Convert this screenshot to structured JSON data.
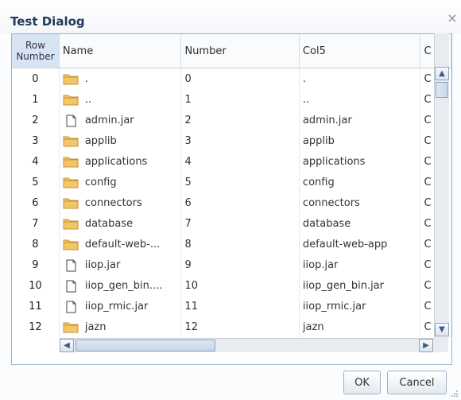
{
  "dialog": {
    "title": "Test Dialog",
    "close_glyph": "×"
  },
  "table": {
    "headers": {
      "row_number_line1": "Row",
      "row_number_line2": "Number",
      "name": "Name",
      "number": "Number",
      "col5": "Col5",
      "col6": "C"
    },
    "rows": [
      {
        "row": "0",
        "icon": "folder-icon",
        "name": ".",
        "number": "0",
        "col5": ".",
        "col6": "C"
      },
      {
        "row": "1",
        "icon": "folder-icon",
        "name": "..",
        "number": "1",
        "col5": "..",
        "col6": "C"
      },
      {
        "row": "2",
        "icon": "file-icon",
        "name": "admin.jar",
        "number": "2",
        "col5": "admin.jar",
        "col6": "C"
      },
      {
        "row": "3",
        "icon": "folder-icon",
        "name": "applib",
        "number": "3",
        "col5": "applib",
        "col6": "C"
      },
      {
        "row": "4",
        "icon": "folder-icon",
        "name": "applications",
        "number": "4",
        "col5": "applications",
        "col6": "C"
      },
      {
        "row": "5",
        "icon": "folder-icon",
        "name": "config",
        "number": "5",
        "col5": "config",
        "col6": "C"
      },
      {
        "row": "6",
        "icon": "folder-icon",
        "name": "connectors",
        "number": "6",
        "col5": "connectors",
        "col6": "C"
      },
      {
        "row": "7",
        "icon": "folder-icon",
        "name": "database",
        "number": "7",
        "col5": "database",
        "col6": "C"
      },
      {
        "row": "8",
        "icon": "folder-icon",
        "name": "default-web-...",
        "number": "8",
        "col5": "default-web-app",
        "col6": "C"
      },
      {
        "row": "9",
        "icon": "file-icon",
        "name": "iiop.jar",
        "number": "9",
        "col5": "iiop.jar",
        "col6": "C"
      },
      {
        "row": "10",
        "icon": "file-icon",
        "name": "iiop_gen_bin....",
        "number": "10",
        "col5": "iiop_gen_bin.jar",
        "col6": "C"
      },
      {
        "row": "11",
        "icon": "file-icon",
        "name": "iiop_rmic.jar",
        "number": "11",
        "col5": "iiop_rmic.jar",
        "col6": "C"
      },
      {
        "row": "12",
        "icon": "folder-icon",
        "name": "jazn",
        "number": "12",
        "col5": "jazn",
        "col6": "C"
      }
    ]
  },
  "buttons": {
    "ok": "OK",
    "cancel": "Cancel"
  },
  "scrollbars": {
    "up_arrow": "▲",
    "down_arrow": "▼",
    "left_arrow": "◀",
    "right_arrow": "▶"
  },
  "colors": {
    "title_text": "#1f3a5c",
    "row_number_header_bg": "#d6e4f3",
    "folder_fill": "#f2c76a",
    "folder_stroke": "#c8932d"
  }
}
